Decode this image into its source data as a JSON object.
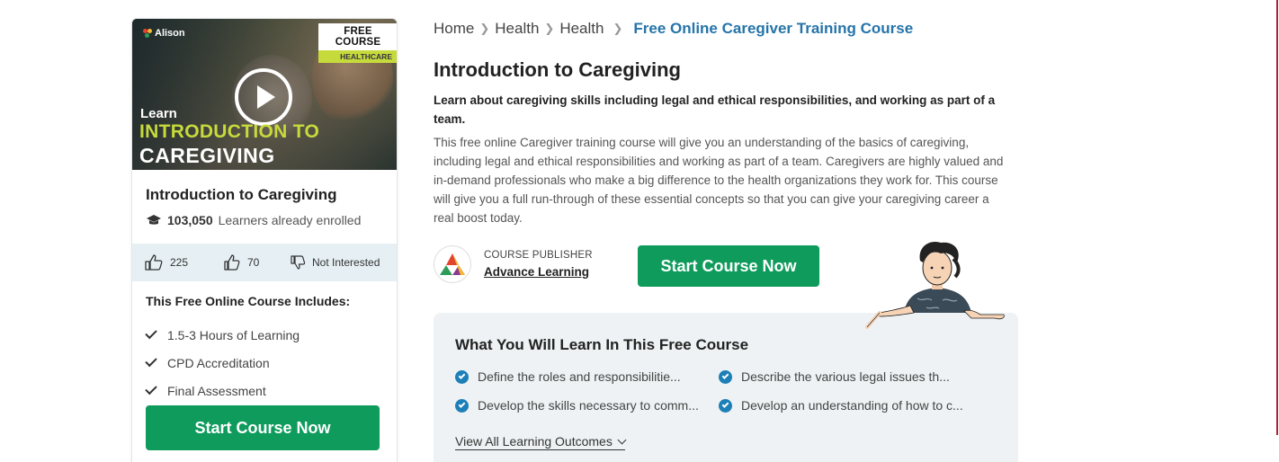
{
  "card": {
    "thumbnail": {
      "brand": "Alison",
      "free_tag": "FREE COURSE",
      "category_tag": "HEALTHCARE",
      "learn": "Learn",
      "headline_1": "INTRODUCTION TO",
      "headline_2": "CAREGIVING",
      "play_icon": "play-icon"
    },
    "title": "Introduction to Caregiving",
    "learners_count": "103,050",
    "learners_label": "Learners already enrolled",
    "likes": "225",
    "dislikes": "70",
    "not_interested": "Not Interested",
    "includes_title": "This Free Online Course Includes:",
    "includes": [
      "1.5-3 Hours of Learning",
      "CPD Accreditation",
      "Final Assessment"
    ],
    "cta": "Start Course Now"
  },
  "breadcrumb": [
    "Home",
    "Health",
    "Health",
    "Free Online Caregiver Training Course"
  ],
  "course": {
    "title": "Introduction to Caregiving",
    "subtitle": "Learn about caregiving skills including legal and ethical responsibilities, and working as part of a team.",
    "description": "This free online Caregiver training course will give you an understanding of the basics of caregiving, including legal and ethical responsibilities and working as part of a team. Caregivers are highly valued and in-demand professionals who make a big difference to the health organizations they work for. This course will give you a full run-through of these essential concepts so that you can give your caregiving career a real boost today.",
    "publisher_label": "COURSE PUBLISHER",
    "publisher_name": "Advance Learning",
    "cta": "Start Course Now"
  },
  "learn_box": {
    "title": "What You Will Learn In This Free Course",
    "outcomes": [
      "Define the roles and responsibilitie...",
      "Describe the various legal issues th...",
      "Develop the skills necessary to comm...",
      "Develop an understanding of how to c..."
    ],
    "view_all": "View All Learning Outcomes"
  },
  "colors": {
    "primary_green": "#0e9b5c",
    "link_blue": "#2574a9",
    "accent_lime": "#c6da3c",
    "rating_bg": "#e6f0f4"
  }
}
